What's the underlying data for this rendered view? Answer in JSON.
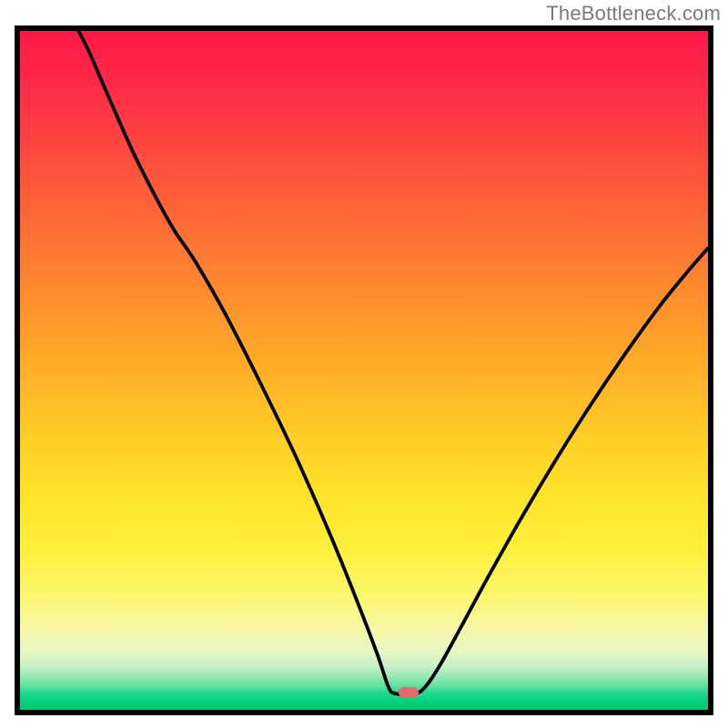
{
  "domain": "Chart",
  "watermark": "TheBottleneck.com",
  "plot": {
    "inner_width": 756,
    "inner_height": 746,
    "marker": {
      "x_pct": 56.5,
      "y_pct": 97.5,
      "color": "#e06a6e"
    }
  },
  "chart_data": {
    "type": "line",
    "title": "",
    "xlabel": "",
    "ylabel": "",
    "x_range_pct": [
      0,
      100
    ],
    "y_range_pct": [
      0,
      100
    ],
    "note": "No axis ticks or numeric labels are rendered; values are pixel-percent coordinates estimated from the image. (0,0) top-left.",
    "series": [
      {
        "name": "bottleneck-curve",
        "color": "#000000",
        "stroke_width": 3.8,
        "points_pct": [
          {
            "x": 8.5,
            "y": 0.0
          },
          {
            "x": 10.0,
            "y": 3.0
          },
          {
            "x": 13.0,
            "y": 10.0
          },
          {
            "x": 16.5,
            "y": 18.0
          },
          {
            "x": 20.0,
            "y": 25.0
          },
          {
            "x": 22.5,
            "y": 29.5
          },
          {
            "x": 25.5,
            "y": 34.0
          },
          {
            "x": 30.0,
            "y": 42.0
          },
          {
            "x": 35.0,
            "y": 52.0
          },
          {
            "x": 40.0,
            "y": 62.5
          },
          {
            "x": 45.0,
            "y": 74.0
          },
          {
            "x": 49.0,
            "y": 84.0
          },
          {
            "x": 52.0,
            "y": 92.0
          },
          {
            "x": 53.5,
            "y": 96.5
          },
          {
            "x": 54.5,
            "y": 97.6
          },
          {
            "x": 57.5,
            "y": 97.6
          },
          {
            "x": 59.0,
            "y": 96.5
          },
          {
            "x": 61.0,
            "y": 93.5
          },
          {
            "x": 64.0,
            "y": 88.0
          },
          {
            "x": 68.0,
            "y": 80.5
          },
          {
            "x": 73.0,
            "y": 71.5
          },
          {
            "x": 78.0,
            "y": 63.0
          },
          {
            "x": 83.0,
            "y": 55.0
          },
          {
            "x": 88.0,
            "y": 47.5
          },
          {
            "x": 93.0,
            "y": 40.5
          },
          {
            "x": 97.0,
            "y": 35.5
          },
          {
            "x": 100.0,
            "y": 32.0
          }
        ]
      }
    ],
    "gradient_stops": [
      {
        "pct": 0,
        "color": "#ff1846"
      },
      {
        "pct": 50,
        "color": "#ffc826"
      },
      {
        "pct": 83,
        "color": "#fcf66a"
      },
      {
        "pct": 100,
        "color": "#00c877"
      }
    ]
  }
}
